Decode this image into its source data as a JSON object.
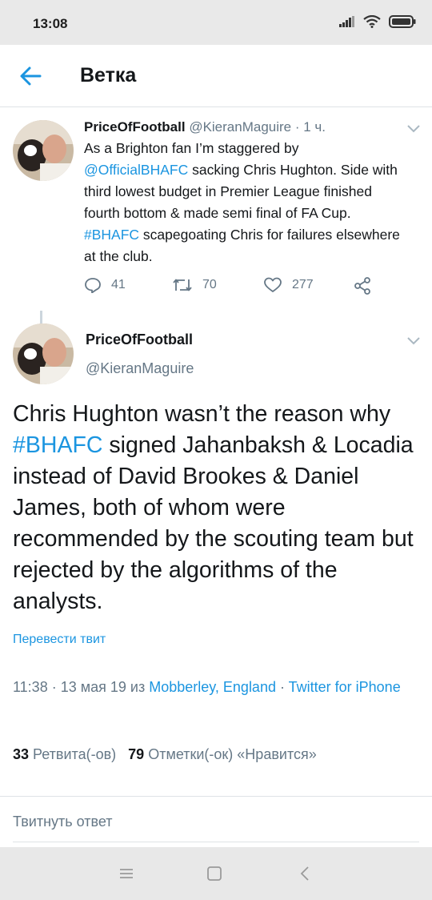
{
  "status_bar": {
    "time": "13:08"
  },
  "header": {
    "title": "Ветка"
  },
  "parent_tweet": {
    "name": "PriceOfFootball",
    "handle": "@KieranMaguire",
    "separator": " · ",
    "time_ago": "1 ч.",
    "text_parts": {
      "p1": "As a Brighton fan I’m staggered by ",
      "mention": "@OfficialBHAFC",
      "p2": " sacking Chris Hughton. Side with third lowest budget in Premier League finished fourth bottom & made semi final of FA Cup. ",
      "hashtag": "#BHAFC",
      "p3": " scapegoating Chris for failures elsewhere at the club."
    },
    "replies": "41",
    "retweets": "70",
    "likes": "277"
  },
  "main_tweet": {
    "name": "PriceOfFootball",
    "handle": "@KieranMaguire",
    "text_parts": {
      "p1": "Chris Hughton wasn’t the reason why ",
      "hashtag": "#BHAFC",
      "p2": " signed Jahanbaksh & Locadia instead of David Brookes & Daniel James, both of whom were recommended by the scouting team but rejected by the algorithms of the analysts."
    },
    "translate_label": "Перевести твит",
    "timestamp": "11:38 · 13 мая 19 из ",
    "location": "Mobberley, England",
    "meta_separator": " · ",
    "source": "Twitter for iPhone",
    "retweet_count": "33",
    "retweet_label": "Ретвита(-ов)",
    "like_count": "79",
    "like_label": "Отметки(-ок) «Нравится»"
  },
  "reply_placeholder": "Твитнуть ответ",
  "colors": {
    "accent": "#1b95e0",
    "secondary_text": "#657786",
    "primary_text": "#14171a"
  }
}
